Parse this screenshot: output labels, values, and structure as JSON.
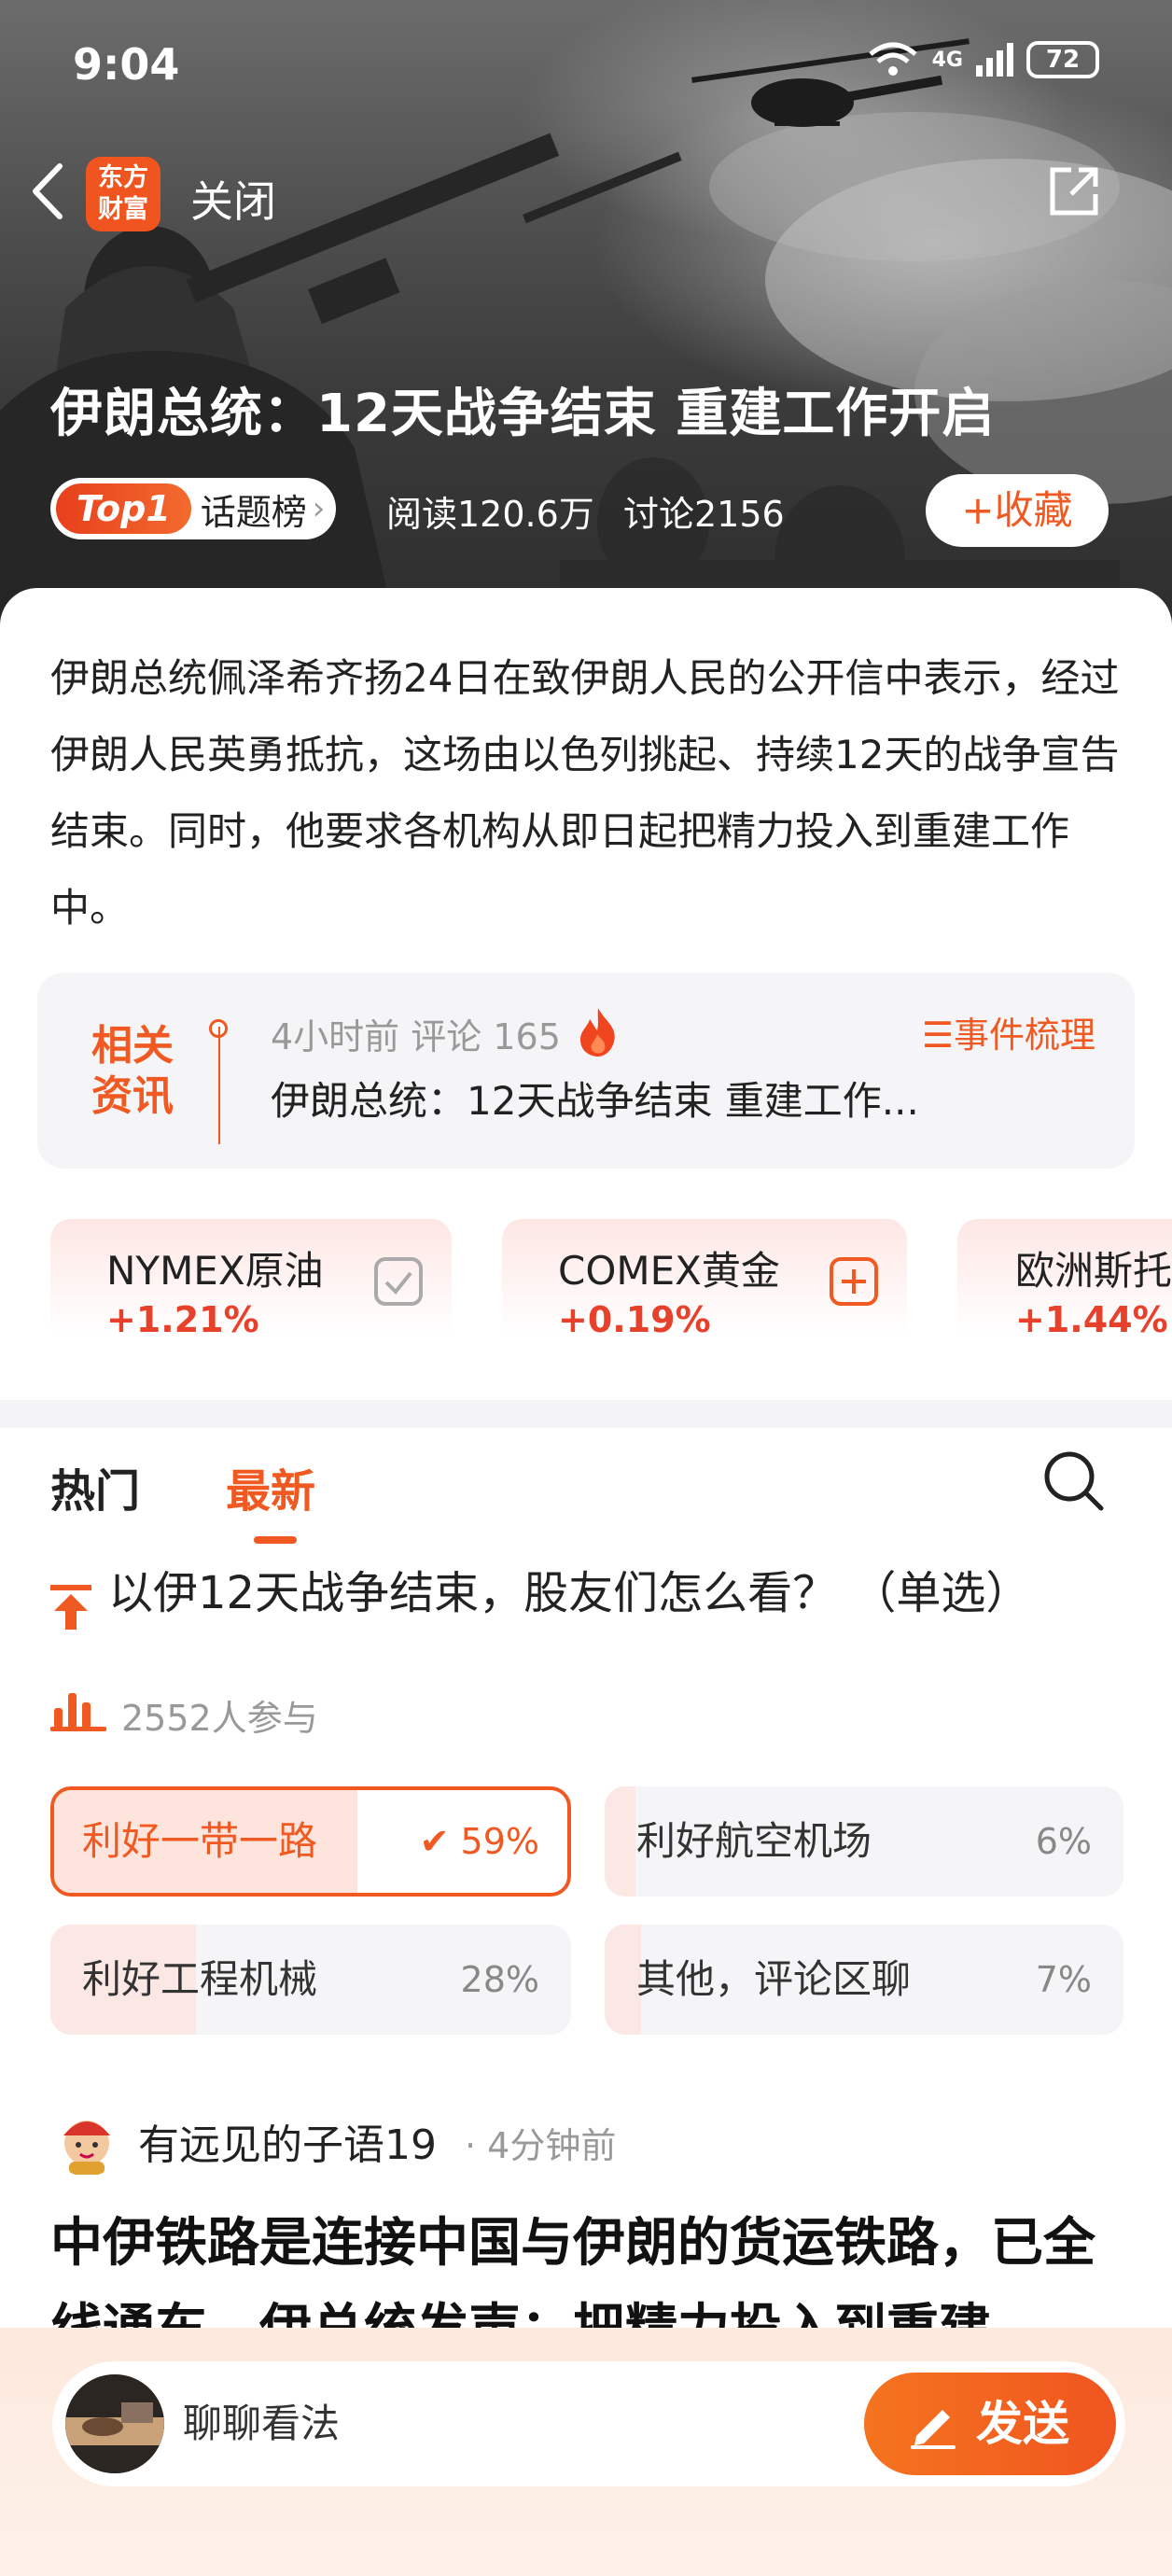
{
  "status_bar": {
    "time": "9:04",
    "network": "4G",
    "battery": "72"
  },
  "nav": {
    "logo_line1": "东方",
    "logo_line2": "财富",
    "close_label": "关闭"
  },
  "topic": {
    "title": "伊朗总统：12天战争结束 重建工作开启",
    "badge_rank": "Top1",
    "badge_label": "话题榜",
    "reads": "阅读120.6万",
    "discussions": "讨论2156",
    "collect_label": "+收藏",
    "summary": "伊朗总统佩泽希齐扬24日在致伊朗人民的公开信中表示，经过伊朗人民英勇抵抗，这场由以色列挑起、持续12天的战争宣告结束。同时，他要求各机构从即日起把精力投入到重建工作中。"
  },
  "related": {
    "tag_line1": "相关",
    "tag_line2": "资讯",
    "meta": "4小时前  评论 165",
    "events_link": "☰事件梳理",
    "headline": "伊朗总统：12天战争结束 重建工作..."
  },
  "quotes": [
    {
      "name": "NYMEX原油",
      "change": "+1.21%",
      "icon": "check-icon"
    },
    {
      "name": "COMEX黄金",
      "change": "+0.19%",
      "icon": "plus-icon"
    },
    {
      "name": "欧洲斯托",
      "change": "+1.44%",
      "icon": "none"
    }
  ],
  "tabs": {
    "hot": "热门",
    "latest": "最新",
    "active": "latest"
  },
  "poll": {
    "question": "以伊12天战争结束，股友们怎么看？ （单选）",
    "participants": "2552人参与",
    "options": [
      {
        "label": "利好一带一路",
        "percent": "✔ 59%",
        "fraction": 0.59,
        "selected": true
      },
      {
        "label": "利好航空机场",
        "percent": "6%",
        "fraction": 0.06,
        "selected": false
      },
      {
        "label": "利好工程机械",
        "percent": "28%",
        "fraction": 0.28,
        "selected": false
      },
      {
        "label": "其他，评论区聊",
        "percent": "7%",
        "fraction": 0.07,
        "selected": false
      }
    ]
  },
  "post": {
    "user": "有远见的子语19",
    "time": "· 4分钟前",
    "body": "中伊铁路是连接中国与伊朗的货运铁路，已全线通车，伊总统发声：把精力投入到重建"
  },
  "comment_bar": {
    "placeholder": "聊聊看法",
    "send_label": "发送"
  },
  "colors": {
    "accent": "#f05a22",
    "up": "#e8412b"
  }
}
